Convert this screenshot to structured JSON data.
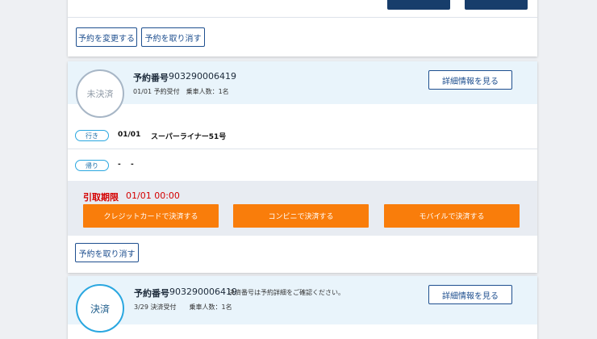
{
  "card1": {
    "change_label": "予約を変更する",
    "cancel_label": "予約を取り消す"
  },
  "card2": {
    "status": "未決済",
    "reservation_label": "予約番号",
    "reservation_number": "903290006419",
    "meta": "01/01 予約受付　乗車人数：1名",
    "details_label": "詳細情報を見る",
    "outbound": {
      "tag": "行き",
      "date": "01/01",
      "train": "スーパーライナー51号"
    },
    "return": {
      "tag": "帰り",
      "date": "-",
      "train": "-"
    },
    "deadline_label": "引取期限",
    "deadline_value": "01/01 00:00",
    "pay_buttons": [
      "クレジットカードで決済する",
      "コンビニで決済する",
      "モバイルで決済する"
    ],
    "cancel_label": "予約を取り消す"
  },
  "card3": {
    "status": "決済",
    "reservation_label": "予約番号",
    "reservation_number": "903290006419",
    "note": "決済番号は予約詳細をご確認ください。",
    "meta": "3/29 決済受付　　乗車人数：1名",
    "details_label": "詳細情報を見る"
  }
}
